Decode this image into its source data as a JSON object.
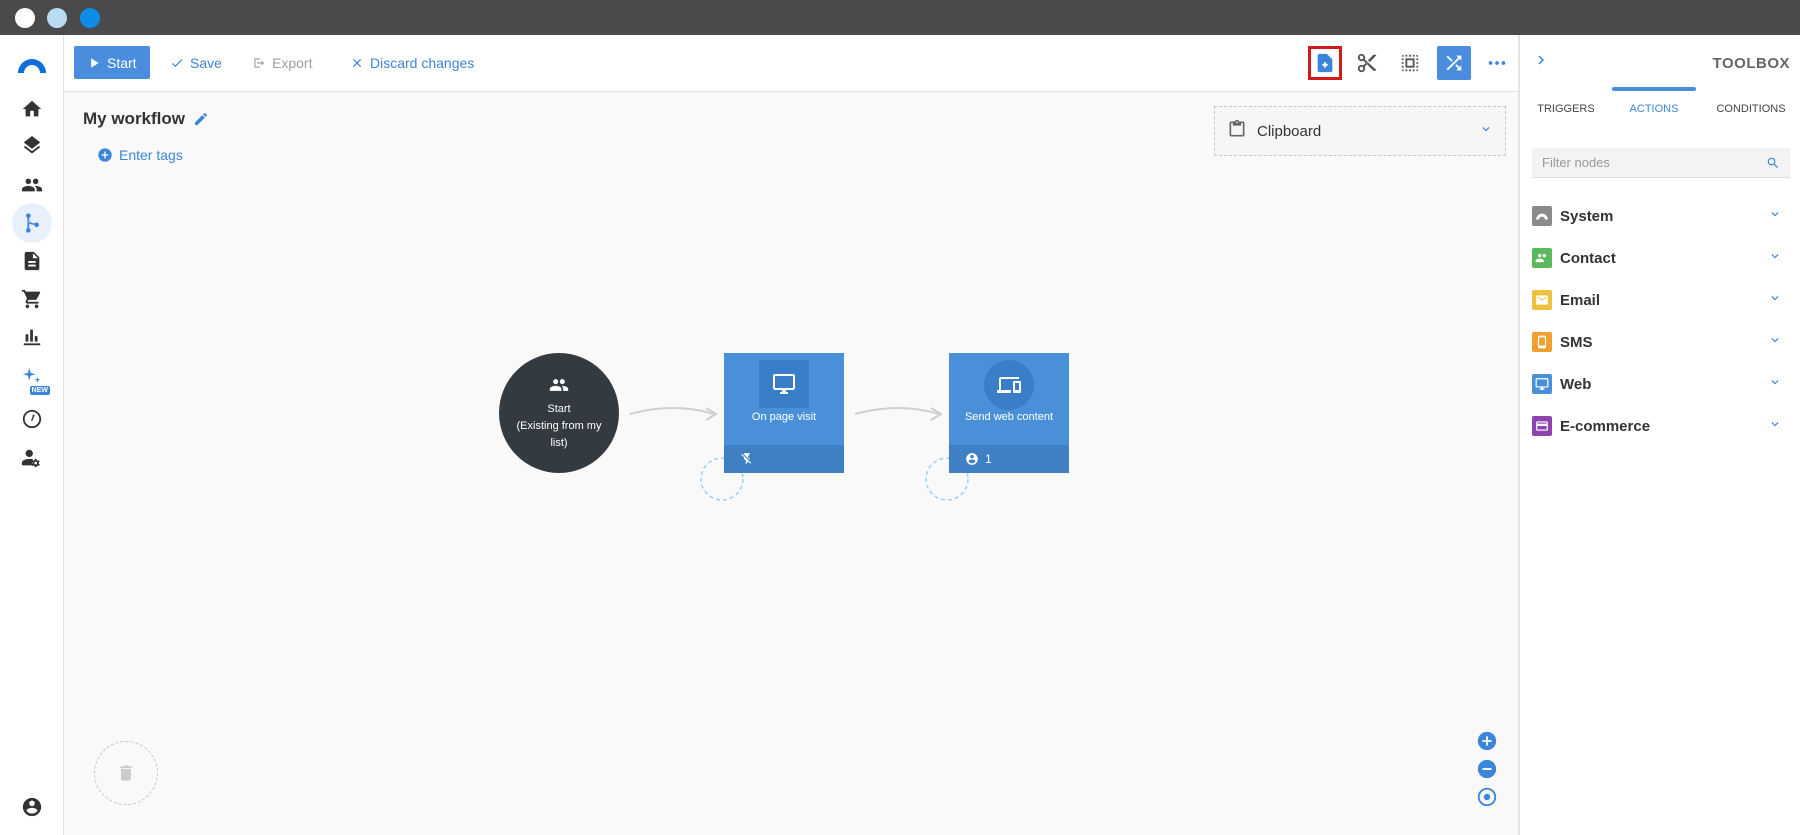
{
  "window": {
    "dots": [
      "#ffffff",
      "#b9dcf5",
      "#0f8ce8"
    ]
  },
  "nav": {
    "items": [
      {
        "name": "home",
        "icon": "home-icon"
      },
      {
        "name": "layers",
        "icon": "layers-icon"
      },
      {
        "name": "contacts",
        "icon": "people-icon"
      },
      {
        "name": "workflows",
        "icon": "workflow-icon",
        "active": true
      },
      {
        "name": "documents",
        "icon": "document-icon"
      },
      {
        "name": "ecommerce",
        "icon": "cart-icon"
      },
      {
        "name": "reports",
        "icon": "bar-chart-icon"
      },
      {
        "name": "ai",
        "icon": "sparkle-icon"
      },
      {
        "name": "dashboard",
        "icon": "gauge-icon"
      },
      {
        "name": "user-settings",
        "icon": "user-gear-icon"
      },
      {
        "name": "account",
        "icon": "account-icon"
      }
    ],
    "new_badge": "NEW"
  },
  "toolbar": {
    "start_label": "Start",
    "save_label": "Save",
    "export_label": "Export",
    "discard_label": "Discard changes"
  },
  "workflow": {
    "title": "My workflow",
    "tags_label": "Enter tags",
    "clipboard_label": "Clipboard",
    "nodes": {
      "start": {
        "line1": "Start",
        "line2": "(Existing from my",
        "line3": "list)"
      },
      "page_visit": {
        "label": "On page visit"
      },
      "web_content": {
        "label": "Send web content",
        "count": "1"
      }
    }
  },
  "toolbox": {
    "title": "TOOLBOX",
    "tabs": [
      "TRIGGERS",
      "ACTIONS",
      "CONDITIONS"
    ],
    "active_tab": "ACTIONS",
    "filter_placeholder": "Filter nodes",
    "categories": [
      {
        "label": "System",
        "color": "#8a8a8a",
        "icon": "system-icon"
      },
      {
        "label": "Contact",
        "color": "#5cb85c",
        "icon": "people-icon"
      },
      {
        "label": "Email",
        "color": "#f0c040",
        "icon": "envelope-icon"
      },
      {
        "label": "SMS",
        "color": "#f0a030",
        "icon": "phone-icon"
      },
      {
        "label": "Web",
        "color": "#4a90d9",
        "icon": "monitor-icon"
      },
      {
        "label": "E-commerce",
        "color": "#8e44ad",
        "icon": "card-icon"
      }
    ]
  },
  "colors": {
    "accent": "#3b86d8",
    "start_node": "#333a40",
    "action_node": "#4a90d9",
    "highlight": "#d11a1a"
  }
}
